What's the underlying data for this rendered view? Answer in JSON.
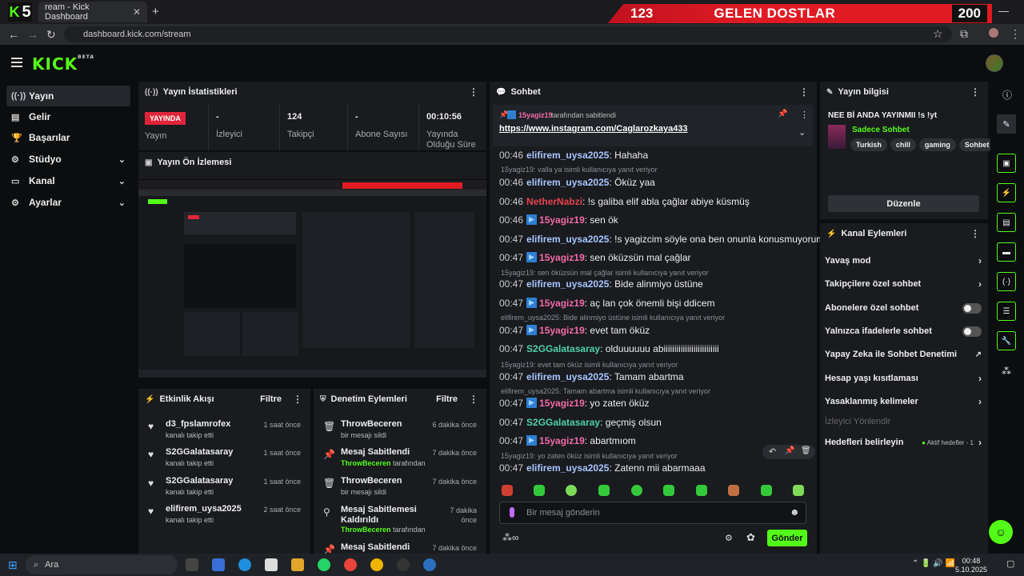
{
  "browser": {
    "tab_number": "5",
    "tab_title": "ream - Kick Dashboard",
    "url": "dashboard.kick.com/stream",
    "overlay": {
      "left_count": "123",
      "title": "GELEN DOSTLAR",
      "right_count": "200"
    }
  },
  "nav": {
    "items": [
      {
        "label": "Yayın",
        "icon": "broadcast-icon"
      },
      {
        "label": "Gelir",
        "icon": "revenue-icon"
      },
      {
        "label": "Başarılar",
        "icon": "trophy-icon"
      },
      {
        "label": "Stüdyo",
        "icon": "studio-icon"
      },
      {
        "label": "Kanal",
        "icon": "channel-icon"
      },
      {
        "label": "Ayarlar",
        "icon": "gear-icon"
      }
    ]
  },
  "stats": {
    "title": "Yayın İstatistikleri",
    "live_badge": "YAYINDA",
    "live_label": "Yayın",
    "viewers_value": "-",
    "viewers_label": "İzleyici",
    "followers_value": "124",
    "followers_label": "Takipçi",
    "subs_value": "-",
    "subs_label": "Abone Sayısı",
    "duration_value": "00:10:56",
    "duration_label": "Yayında Olduğu Süre"
  },
  "preview": {
    "title": "Yayın Ön İzlemesi"
  },
  "activity": {
    "title": "Etkinlik Akışı",
    "filter": "Filtre",
    "rows": [
      {
        "name": "d3_fpslamrofex",
        "sub": "kanalı takip etti",
        "time": "1 saat önce"
      },
      {
        "name": "S2GGalatasaray",
        "sub": "kanalı takip etti",
        "time": "1 saat önce"
      },
      {
        "name": "S2GGalatasaray",
        "sub": "kanalı takip etti",
        "time": "1 saat önce"
      },
      {
        "name": "elifirem_uysa2025",
        "sub": "kanalı takip etti",
        "time": "2 saat önce"
      }
    ]
  },
  "moderation": {
    "title": "Denetim Eylemleri",
    "filter": "Filtre",
    "rows": [
      {
        "name": "ThrowBeceren",
        "sub": "bir mesajı sildi",
        "time": "6 dakika önce"
      },
      {
        "name": "Mesaj Sabitlendi",
        "sub_user": "ThrowBeceren",
        "sub": "tarafından",
        "time": "7 dakika önce"
      },
      {
        "name": "ThrowBeceren",
        "sub": "bir mesajı sildi",
        "time": "7 dakika önce"
      },
      {
        "name": "Mesaj Sabitlemesi Kaldırıldı",
        "sub_user": "ThrowBeceren",
        "sub": "tarafından",
        "time": "7 dakika önce"
      },
      {
        "name": "Mesaj Sabitlendi",
        "time": "7 dakika önce"
      }
    ]
  },
  "chat": {
    "title": "Sohbet",
    "pinned_by": "15yagiz19",
    "pinned_by_suffix": "tarafından sabitlendi",
    "pinned_link": "https://www.instagram.com/Caglarozkaya433",
    "lines": [
      {
        "time": "00:46",
        "user": "elifirem_uysa2025",
        "color": "#a9c6ff",
        "text": "Hahaha"
      },
      {
        "reply": "15yagiz19: valla ya isimli kullanıcıya yanıt veriyor"
      },
      {
        "time": "00:46",
        "user": "elifirem_uysa2025",
        "color": "#a9c6ff",
        "text": "Öküz yaa"
      },
      {
        "time": "00:46",
        "user": "NetherNabzi",
        "color": "#e8434f",
        "text": "!s galiba elif abla çağlar abiye küsmüş"
      },
      {
        "time": "00:46",
        "user": "15yagiz19",
        "color": "#f46aa8",
        "badge": true,
        "text": "sen ök"
      },
      {
        "time": "00:47",
        "user": "elifirem_uysa2025",
        "color": "#a9c6ff",
        "text": "!s yagizcim söyle ona ben onunla konusmuyorum"
      },
      {
        "time": "00:47",
        "user": "15yagiz19",
        "color": "#f46aa8",
        "badge": true,
        "text": "sen öküzsün mal çağlar"
      },
      {
        "reply": "15yagiz19: sen öküzsün mal çağlar isimli kullanıcıya yanıt veriyor"
      },
      {
        "time": "00:47",
        "user": "elifirem_uysa2025",
        "color": "#a9c6ff",
        "text": "Bide alinmiyo üstüne"
      },
      {
        "time": "00:47",
        "user": "15yagiz19",
        "color": "#f46aa8",
        "badge": true,
        "text": "aç lan çok önemli bişi ddicem"
      },
      {
        "reply": "elifirem_uysa2025: Bide alinmiyo üstüne isimli kullanıcıya yanıt veriyor"
      },
      {
        "time": "00:47",
        "user": "15yagiz19",
        "color": "#f46aa8",
        "badge": true,
        "text": "evet tam öküz"
      },
      {
        "time": "00:47",
        "user": "S2GGalatasaray",
        "color": "#4fd1a6",
        "text": "olduuuuuu abiiiiiiiiiiiiiiiiiiiiiiiiii"
      },
      {
        "reply": "15yagiz19: evet tam öküz isimli kullanıcıya yanıt veriyor"
      },
      {
        "time": "00:47",
        "user": "elifirem_uysa2025",
        "color": "#a9c6ff",
        "text": "Tamam abartma"
      },
      {
        "reply": "elifirem_uysa2025: Tamam abartma isimli kullanıcıya yanıt veriyor"
      },
      {
        "time": "00:47",
        "user": "15yagiz19",
        "color": "#f46aa8",
        "badge": true,
        "text": "yo zaten öküz"
      },
      {
        "time": "00:47",
        "user": "S2GGalatasaray",
        "color": "#4fd1a6",
        "text": "geçmiş olsun"
      },
      {
        "time": "00:47",
        "user": "15yagiz19",
        "color": "#f46aa8",
        "badge": true,
        "text": "abartmıom"
      },
      {
        "reply": "15yagiz19: yo zaten öküz isimli kullanıcıya yanıt veriyor"
      },
      {
        "time": "00:47",
        "user": "elifirem_uysa2025",
        "color": "#a9c6ff",
        "text": "Zatenn mii abarmaaa"
      }
    ],
    "input_placeholder": "Bir mesaj gönderin",
    "send_label": "Gönder"
  },
  "stream_info": {
    "title": "Yayın bilgisi",
    "stream_title": "NEE Bİ ANDA YAYINMII !s !yt",
    "category": "Sadece Sohbet",
    "tags": [
      "Turkish",
      "chill",
      "gaming",
      "Sohbet"
    ],
    "edit_label": "Düzenle"
  },
  "channel_actions": {
    "title": "Kanal Eylemleri",
    "items": [
      {
        "label": "Yavaş mod",
        "type": "chevron"
      },
      {
        "label": "Takipçilere özel sohbet",
        "type": "chevron"
      },
      {
        "label": "Abonelere özel sohbet",
        "type": "toggle"
      },
      {
        "label": "Yalnızca ifadelerle sohbet",
        "type": "toggle"
      },
      {
        "label": "Yapay Zeka ile Sohbet Denetimi",
        "type": "external"
      },
      {
        "label": "Hesap yaşı kısıtlaması",
        "type": "chevron"
      },
      {
        "label": "Yasaklanmış kelimeler",
        "type": "chevron"
      }
    ],
    "disabled_item": "İzleyici Yönlendir",
    "goals_label": "Hedefleri belirleyin",
    "goals_status": "Aktif hedefler - 1"
  },
  "taskbar": {
    "search_placeholder": "Ara",
    "time": "00:48",
    "date": "5.10.2025"
  },
  "colors": {
    "accent": "#53fc18",
    "live": "#e0243a",
    "panel": "#191b1f"
  }
}
